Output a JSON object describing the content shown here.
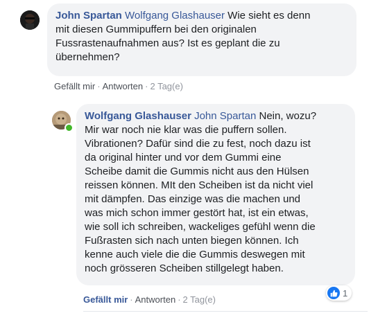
{
  "comment1": {
    "author": "John Spartan",
    "mention": "Wolfgang Glashauser",
    "text_line1": " Wie sieht es denn",
    "text_lines": [
      "mit diesen Gummipuffern bei den originalen",
      "Fussrastenaufnahmen aus? Ist es geplant die zu",
      "übernehmen?"
    ],
    "actions": {
      "like": "Gefällt mir",
      "reply": "Antworten",
      "time": "2 Tag(e)",
      "separator": "·"
    }
  },
  "comment2": {
    "author": "Wolfgang Glashauser",
    "mention": "John Spartan",
    "text_line1": " Nein, wozu?",
    "text_lines": [
      "Mir war noch nie klar was die puffern sollen.",
      "Vibrationen? Dafür sind die zu fest, noch dazu ist",
      "da original hinter und vor dem Gummi eine",
      "Scheibe damit die Gummis nicht aus den Hülsen",
      "reissen können. MIt den Scheiben ist da nicht viel",
      "mit dämpfen. Das einzige was die machen und",
      "was mich schon immer gestört hat, ist ein etwas,",
      "wie soll ich schreiben, wackeliges gefühl wenn die",
      "Fußrasten sich nach unten biegen können. Ich",
      "kenne auch viele die die Gummis deswegen mit",
      "noch grösseren Scheiben stillgelegt haben."
    ],
    "reaction": {
      "icon": "like-icon",
      "count": "1"
    },
    "actions": {
      "like": "Gefällt mir",
      "reply": "Antworten",
      "time": "2 Tag(e)",
      "separator": "·"
    }
  },
  "colors": {
    "name": "#385898",
    "bubble": "#f2f3f5",
    "like_blue": "#1877f2",
    "online": "#42b72a"
  }
}
